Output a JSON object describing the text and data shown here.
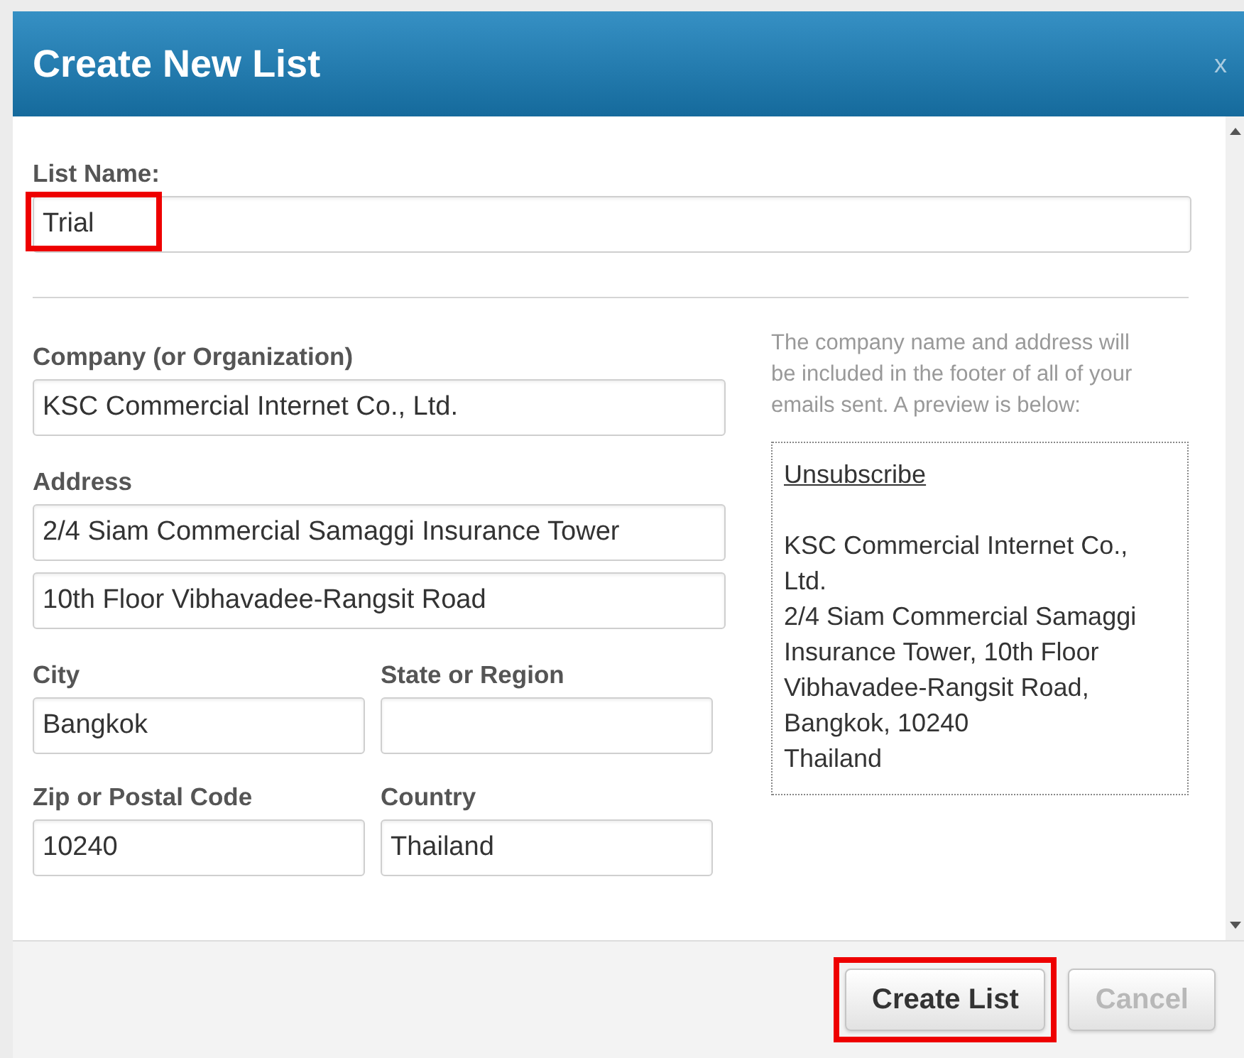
{
  "dialog": {
    "title": "Create New List",
    "close": "x"
  },
  "list_name": {
    "label": "List Name:",
    "value": "Trial",
    "highlighted": true
  },
  "company": {
    "label": "Company (or Organization)",
    "value": "KSC Commercial Internet Co., Ltd."
  },
  "address": {
    "label": "Address",
    "lines": [
      "2/4 Siam Commercial Samaggi Insurance Tower",
      "10th Floor Vibhavadee-Rangsit Road"
    ]
  },
  "pairs": [
    [
      {
        "label": "City",
        "value": "Bangkok"
      },
      {
        "label": "State or Region"
      }
    ],
    [
      {
        "label": "Zip or Postal Code",
        "value": "10240"
      },
      {
        "label": "Country",
        "value": "Thailand"
      }
    ]
  ],
  "note": "The company name and address will be included in the footer of all of your emails sent. A preview is below:",
  "preview": {
    "link": "Unsubscribe",
    "lines": [
      "KSC Commercial Internet Co., Ltd.",
      "2/4 Siam Commercial Samaggi Insurance Tower, 10th Floor Vibhavadee-Rangsit Road,",
      "Bangkok, 10240",
      "Thailand"
    ]
  },
  "buttons": [
    {
      "label": "Create List",
      "disabled": false,
      "highlighted": true
    },
    {
      "label": "Cancel",
      "disabled": true,
      "highlighted": false
    }
  ]
}
